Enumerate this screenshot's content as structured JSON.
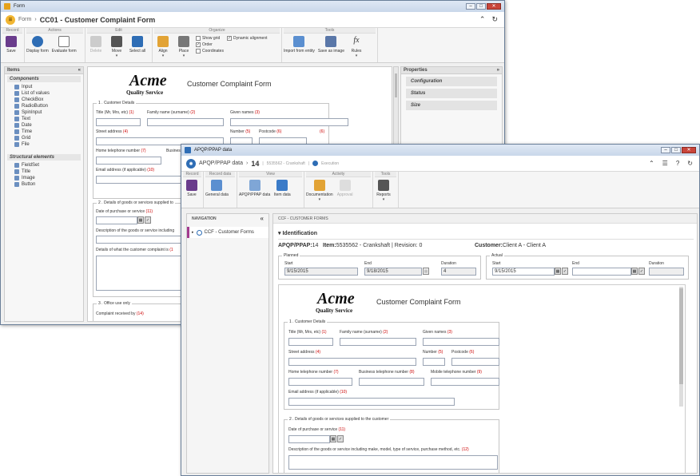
{
  "win1": {
    "title": "Form",
    "crumb": "Form",
    "header": "CC01 - Customer Complaint Form",
    "groups": {
      "record": "Record",
      "actions": "Actions",
      "edit": "Edit",
      "organize": "Organize",
      "tools": "Tools"
    },
    "buttons": {
      "save": "Save",
      "display_form": "Display form",
      "evaluate_form": "Evaluate form",
      "delete": "Delete",
      "move": "Move",
      "select_all": "Select all",
      "align": "Align",
      "place": "Place",
      "import": "Import from entity",
      "save_image": "Save as image",
      "rules": "Rules"
    },
    "checks": {
      "show_grid": "Show grid",
      "order": "Order",
      "coordinates": "Coordinates",
      "dynamic_alignment": "Dynamic alignment"
    },
    "items_title": "Items",
    "components_title": "Components",
    "components": [
      "Input",
      "List of values",
      "CheckBox",
      "RadioButton",
      "SpinInput",
      "Text",
      "Date",
      "Time",
      "Grid",
      "File"
    ],
    "structural_title": "Structural elements",
    "structural": [
      "FieldSet",
      "Title",
      "Image",
      "Button"
    ],
    "properties_title": "Properties",
    "properties": [
      "Configuration",
      "Status",
      "Size"
    ],
    "form": {
      "brand": "Acme",
      "brand_sub": "Quality Service",
      "title": "Customer Complaint Form",
      "fs1": "1 . Customer Details",
      "f_title": "Title (Mr, Mrs, etc)",
      "n_title": "(1)",
      "f_family": "Family name (surname)",
      "n_family": "(2)",
      "f_given": "Given names",
      "n_given": "(3)",
      "f_street": "Street address",
      "n_street": "(4)",
      "f_number": "Number",
      "n_number": "(5)",
      "f_post": "Postcode",
      "n_post": "(6)",
      "n_extra": "(6)",
      "f_home": "Home telephone number",
      "n_home": "(7)",
      "f_bus": "Busines",
      "f_email": "Email address (if applicable)",
      "n_email": "(10)",
      "fs2": "2 . Details of goods or services supplied to",
      "f_date": "Date of purchase or service",
      "n_date": "(11)",
      "f_desc": "Description of the goods or service including",
      "f_what": "Details of what the customer complaint is",
      "n_what": "(1",
      "fs3": "3 . Office use only",
      "f_received": "Complaint received by",
      "n_received": "(14)"
    }
  },
  "win2": {
    "title": "APQP/PPAP data",
    "crumb": "APQP/PPAP data",
    "num": "14",
    "item": "5535562 - Crankshaft",
    "status": "Execution",
    "groups": {
      "record": "Record",
      "record_data": "Record data",
      "view": "View",
      "activity": "Activity",
      "tools": "Tools"
    },
    "buttons": {
      "save": "Save",
      "general": "General data",
      "apqp": "APQP/PPAP data",
      "item_data": "Item data",
      "documentation": "Documentation",
      "approval": "Approval",
      "reports": "Reports"
    },
    "nav_title": "NAVIGATION",
    "nav_item": "CCF - Customer Forms",
    "main_title": "CCF - CUSTOMER FORMS",
    "ident": "Identification",
    "apqp_label": "APQP/PPAP:",
    "apqp_val": "14",
    "item_label": "Item:",
    "item_val": "5535562 - Crankshaft | Revision: 0",
    "cust_label": "Customer:",
    "cust_val": "Client A - Client A",
    "planned": "Planned",
    "actual": "Actual",
    "start": "Start",
    "end": "End",
    "duration": "Duration",
    "p_start": "9/15/2015",
    "p_end": "9/18/2015",
    "p_dur": "4",
    "a_start": "9/15/2015",
    "a_end": "",
    "a_dur": "",
    "form": {
      "brand": "Acme",
      "brand_sub": "Quality Service",
      "title": "Customer Complaint Form",
      "fs1": "1 . Customer Details",
      "f_title": "Title (Mr, Mrs, etc)",
      "n_title": "(1)",
      "f_family": "Family name (surname)",
      "n_family": "(2)",
      "f_given": "Given names",
      "n_given": "(3)",
      "f_street": "Street address",
      "n_street": "(4)",
      "f_number": "Number",
      "n_number": "(5)",
      "f_post": "Postcode",
      "n_post": "(6)",
      "f_home": "Home telephone number",
      "n_home": "(7)",
      "f_bus": "Business telephone number",
      "n_bus": "(8)",
      "f_mobile": "Mobile telephone number",
      "n_mobile": "(9)",
      "f_email": "Email address (if applicable)",
      "n_email": "(10)",
      "fs2": "2 . Details of goods or services supplied to the customer",
      "f_date": "Date of purchase or service",
      "n_date": "(11)",
      "f_desc": "Description of the goods or service including make, model, type of service, purchase method, etc.",
      "n_desc": "(12)"
    }
  },
  "colors": {
    "accent": "#2e6db5",
    "nav_marker": "#a33b8f",
    "brand": "#f2b632"
  }
}
